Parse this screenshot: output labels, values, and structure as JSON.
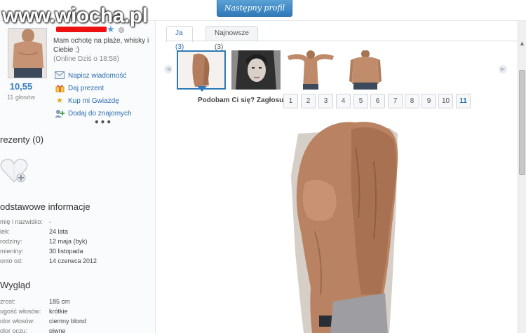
{
  "watermark": {
    "brand": "www.wiocha.pl"
  },
  "topbar": {
    "next_profile": "Następny profil"
  },
  "profile": {
    "status": "Mam ochotę na plaże, whisky i Ciebie :)",
    "online": "(Online Dziś o 18:58)",
    "score": "10,55",
    "votes": "11 głosów"
  },
  "actions": [
    {
      "label": "Napisz wiadomość",
      "icon": "envelope-icon"
    },
    {
      "label": "Daj prezent",
      "icon": "gift-icon"
    },
    {
      "label": "Kup mi Gwiazdę",
      "icon": "star-icon"
    },
    {
      "label": "Dodaj do znajomych",
      "icon": "add-friend-icon"
    }
  ],
  "more": "•••",
  "gifts": {
    "title": "rezenty (0)"
  },
  "basic_info": {
    "title": "odstawowe informacje",
    "rows": [
      {
        "k": "mię i nazwisko:",
        "v": "-"
      },
      {
        "k": "iek:",
        "v": "24 lata"
      },
      {
        "k": "rodziny:",
        "v": "12 maja (byk)"
      },
      {
        "k": "mieniny:",
        "v": "30 listopada"
      },
      {
        "k": "onto od:",
        "v": "14 czerwca 2012"
      }
    ]
  },
  "appearance": {
    "title": "Wygląd",
    "rows": [
      {
        "k": "zrost:",
        "v": "185 cm"
      },
      {
        "k": "ugość włosów:",
        "v": "krótkie"
      },
      {
        "k": "olor włosów:",
        "v": "ciemny blond"
      },
      {
        "k": "olor oczu:",
        "v": "piwne"
      }
    ]
  },
  "tabs": [
    {
      "label": "Ja (3)",
      "active": true
    },
    {
      "label": "Najnowsze (3)",
      "active": false
    }
  ],
  "vote": {
    "label": "Podobam Ci się? Zagłosuj:",
    "options": [
      "1",
      "2",
      "3",
      "4",
      "5",
      "6",
      "7",
      "8",
      "9",
      "10",
      "11"
    ]
  },
  "colors": {
    "accent": "#2f79b8",
    "link": "#2e6fb0",
    "name_redacted": "#ee1111"
  }
}
